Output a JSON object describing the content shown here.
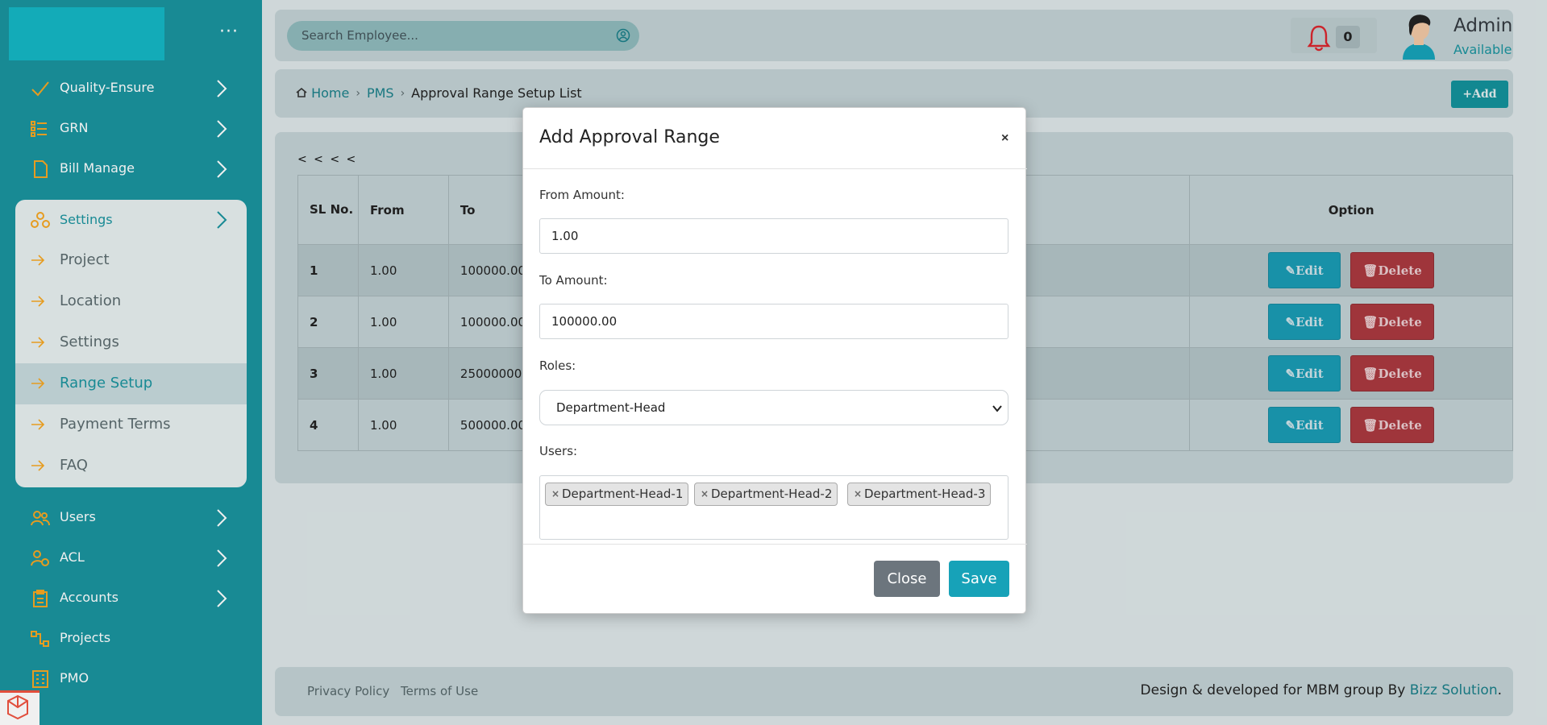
{
  "sidebar": {
    "items_top": [
      {
        "label": "Quality-Ensure",
        "icon": "check-icon"
      },
      {
        "label": "GRN",
        "icon": "list-icon"
      },
      {
        "label": "Bill Manage",
        "icon": "file-icon"
      }
    ],
    "settings_group": {
      "label": "Settings",
      "items": [
        {
          "label": "Project"
        },
        {
          "label": "Location"
        },
        {
          "label": "Settings"
        },
        {
          "label": "Range Setup"
        },
        {
          "label": "Payment Terms"
        },
        {
          "label": "FAQ"
        }
      ],
      "active": "Range Setup"
    },
    "items_bottom": [
      {
        "label": "Users",
        "icon": "users-icon"
      },
      {
        "label": "ACL",
        "icon": "user-shield-icon"
      },
      {
        "label": "Accounts",
        "icon": "clipboard-icon"
      },
      {
        "label": "Projects",
        "icon": "network-icon"
      },
      {
        "label": "PMO",
        "icon": "building-icon"
      }
    ]
  },
  "header": {
    "search_placeholder": "Search Employee...",
    "notification_count": "0",
    "user_name": "Admin",
    "user_status": "Available"
  },
  "breadcrumb": {
    "home": "Home",
    "section": "PMS",
    "current": "Approval Range Setup List"
  },
  "toolbar": {
    "add_label": "+Add"
  },
  "table": {
    "pager": "< < < <",
    "columns": {
      "sl": "SL No.",
      "from": "From",
      "to": "To",
      "option": "Option"
    },
    "rows": [
      {
        "sl": "1",
        "from": "1.00",
        "to": "100000.00"
      },
      {
        "sl": "2",
        "from": "1.00",
        "to": "100000.00"
      },
      {
        "sl": "3",
        "from": "1.00",
        "to": "25000000."
      },
      {
        "sl": "4",
        "from": "1.00",
        "to": "500000.00"
      }
    ],
    "edit_label": "Edit",
    "delete_label": "Delete"
  },
  "footer": {
    "privacy": "Privacy Policy",
    "terms": "Terms of Use",
    "credit_prefix": "Design & developed for MBM group By ",
    "credit_link": "Bizz Solution",
    "credit_suffix": "."
  },
  "modal": {
    "title": "Add Approval Range",
    "close_symbol": "×",
    "from_label": "From Amount:",
    "from_value": "1.00",
    "to_label": "To Amount:",
    "to_value": "100000.00",
    "roles_label": "Roles:",
    "roles_selected": "Department-Head",
    "users_label": "Users:",
    "users_tags": [
      "Department-Head-1",
      "Department-Head-2",
      "Department-Head-3"
    ],
    "tag_remove_symbol": "×",
    "close_button": "Close",
    "save_button": "Save"
  },
  "colors": {
    "sidebar": "#1a939e",
    "accent": "#17a2b8",
    "danger": "#a9393f"
  }
}
